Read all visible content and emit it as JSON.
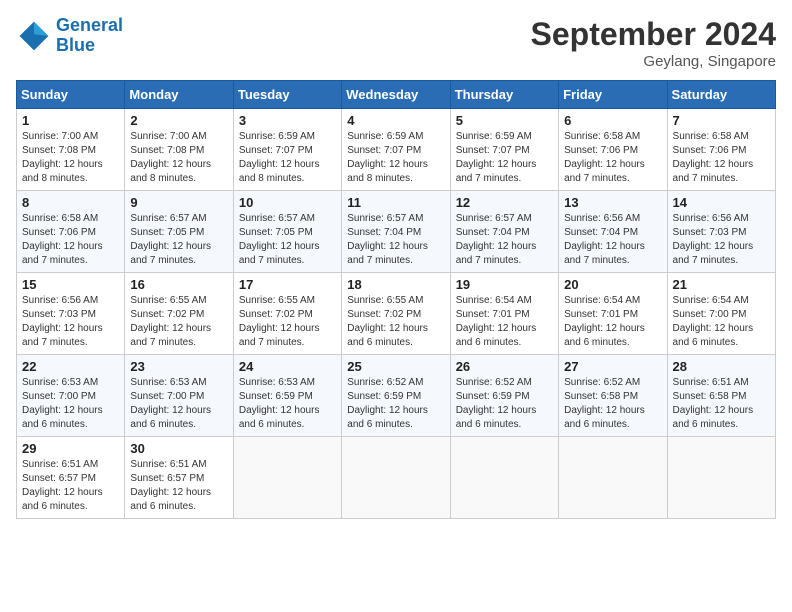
{
  "logo": {
    "line1": "General",
    "line2": "Blue"
  },
  "title": "September 2024",
  "location": "Geylang, Singapore",
  "days_of_week": [
    "Sunday",
    "Monday",
    "Tuesday",
    "Wednesday",
    "Thursday",
    "Friday",
    "Saturday"
  ],
  "weeks": [
    [
      {
        "day": "1",
        "sunrise": "7:00 AM",
        "sunset": "7:08 PM",
        "daylight": "12 hours and 8 minutes."
      },
      {
        "day": "2",
        "sunrise": "7:00 AM",
        "sunset": "7:08 PM",
        "daylight": "12 hours and 8 minutes."
      },
      {
        "day": "3",
        "sunrise": "6:59 AM",
        "sunset": "7:07 PM",
        "daylight": "12 hours and 8 minutes."
      },
      {
        "day": "4",
        "sunrise": "6:59 AM",
        "sunset": "7:07 PM",
        "daylight": "12 hours and 8 minutes."
      },
      {
        "day": "5",
        "sunrise": "6:59 AM",
        "sunset": "7:07 PM",
        "daylight": "12 hours and 7 minutes."
      },
      {
        "day": "6",
        "sunrise": "6:58 AM",
        "sunset": "7:06 PM",
        "daylight": "12 hours and 7 minutes."
      },
      {
        "day": "7",
        "sunrise": "6:58 AM",
        "sunset": "7:06 PM",
        "daylight": "12 hours and 7 minutes."
      }
    ],
    [
      {
        "day": "8",
        "sunrise": "6:58 AM",
        "sunset": "7:06 PM",
        "daylight": "12 hours and 7 minutes."
      },
      {
        "day": "9",
        "sunrise": "6:57 AM",
        "sunset": "7:05 PM",
        "daylight": "12 hours and 7 minutes."
      },
      {
        "day": "10",
        "sunrise": "6:57 AM",
        "sunset": "7:05 PM",
        "daylight": "12 hours and 7 minutes."
      },
      {
        "day": "11",
        "sunrise": "6:57 AM",
        "sunset": "7:04 PM",
        "daylight": "12 hours and 7 minutes."
      },
      {
        "day": "12",
        "sunrise": "6:57 AM",
        "sunset": "7:04 PM",
        "daylight": "12 hours and 7 minutes."
      },
      {
        "day": "13",
        "sunrise": "6:56 AM",
        "sunset": "7:04 PM",
        "daylight": "12 hours and 7 minutes."
      },
      {
        "day": "14",
        "sunrise": "6:56 AM",
        "sunset": "7:03 PM",
        "daylight": "12 hours and 7 minutes."
      }
    ],
    [
      {
        "day": "15",
        "sunrise": "6:56 AM",
        "sunset": "7:03 PM",
        "daylight": "12 hours and 7 minutes."
      },
      {
        "day": "16",
        "sunrise": "6:55 AM",
        "sunset": "7:02 PM",
        "daylight": "12 hours and 7 minutes."
      },
      {
        "day": "17",
        "sunrise": "6:55 AM",
        "sunset": "7:02 PM",
        "daylight": "12 hours and 7 minutes."
      },
      {
        "day": "18",
        "sunrise": "6:55 AM",
        "sunset": "7:02 PM",
        "daylight": "12 hours and 6 minutes."
      },
      {
        "day": "19",
        "sunrise": "6:54 AM",
        "sunset": "7:01 PM",
        "daylight": "12 hours and 6 minutes."
      },
      {
        "day": "20",
        "sunrise": "6:54 AM",
        "sunset": "7:01 PM",
        "daylight": "12 hours and 6 minutes."
      },
      {
        "day": "21",
        "sunrise": "6:54 AM",
        "sunset": "7:00 PM",
        "daylight": "12 hours and 6 minutes."
      }
    ],
    [
      {
        "day": "22",
        "sunrise": "6:53 AM",
        "sunset": "7:00 PM",
        "daylight": "12 hours and 6 minutes."
      },
      {
        "day": "23",
        "sunrise": "6:53 AM",
        "sunset": "7:00 PM",
        "daylight": "12 hours and 6 minutes."
      },
      {
        "day": "24",
        "sunrise": "6:53 AM",
        "sunset": "6:59 PM",
        "daylight": "12 hours and 6 minutes."
      },
      {
        "day": "25",
        "sunrise": "6:52 AM",
        "sunset": "6:59 PM",
        "daylight": "12 hours and 6 minutes."
      },
      {
        "day": "26",
        "sunrise": "6:52 AM",
        "sunset": "6:59 PM",
        "daylight": "12 hours and 6 minutes."
      },
      {
        "day": "27",
        "sunrise": "6:52 AM",
        "sunset": "6:58 PM",
        "daylight": "12 hours and 6 minutes."
      },
      {
        "day": "28",
        "sunrise": "6:51 AM",
        "sunset": "6:58 PM",
        "daylight": "12 hours and 6 minutes."
      }
    ],
    [
      {
        "day": "29",
        "sunrise": "6:51 AM",
        "sunset": "6:57 PM",
        "daylight": "12 hours and 6 minutes."
      },
      {
        "day": "30",
        "sunrise": "6:51 AM",
        "sunset": "6:57 PM",
        "daylight": "12 hours and 6 minutes."
      },
      null,
      null,
      null,
      null,
      null
    ]
  ]
}
